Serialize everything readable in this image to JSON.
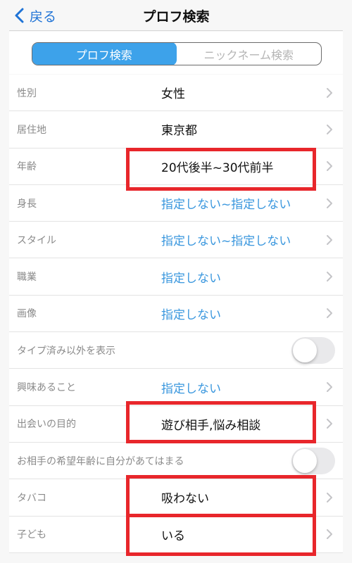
{
  "nav": {
    "back_label": "戻る",
    "title": "プロフ検索"
  },
  "segments": [
    {
      "label": "プロフ検索",
      "selected": true
    },
    {
      "label": "ニックネーム検索",
      "selected": false
    }
  ],
  "rows": [
    {
      "label": "性別",
      "value": "女性"
    },
    {
      "label": "居住地",
      "value": "東京都"
    },
    {
      "label": "年齢",
      "value": "20代後半~30代前半"
    },
    {
      "label": "身長",
      "value": "指定しない~指定しない"
    },
    {
      "label": "スタイル",
      "value": "指定しない~指定しない"
    },
    {
      "label": "職業",
      "value": "指定しない"
    },
    {
      "label": "画像",
      "value": "指定しない"
    },
    {
      "label": "タイプ済み以外を表示",
      "toggle": false
    },
    {
      "label": "興味あること",
      "value": "指定しない"
    },
    {
      "label": "出会いの目的",
      "value": "遊び相手,悩み相談"
    },
    {
      "label": "お相手の希望年齢に自分があてはまる",
      "toggle": false
    },
    {
      "label": "タバコ",
      "value": "吸わない"
    },
    {
      "label": "子ども",
      "value": "いる"
    }
  ],
  "colors": {
    "accent": "#3da2ea",
    "link_blue": "#3a97de",
    "nav_blue": "#1f73d6",
    "highlight_red": "#e8262b"
  }
}
